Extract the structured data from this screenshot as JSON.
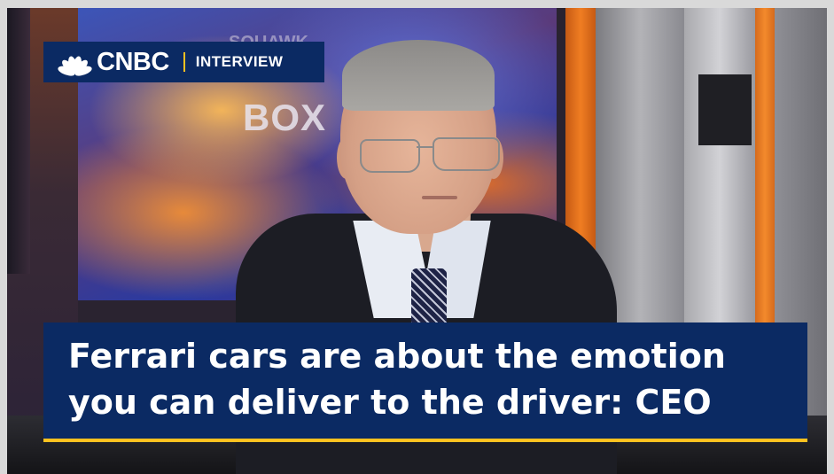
{
  "logo": {
    "brand": "CNBC",
    "icon": "peacock-icon",
    "segment": "INTERVIEW"
  },
  "background": {
    "wall_text": "BOX",
    "wall_text_top": "SQUAWK"
  },
  "headline": {
    "line1": "Ferrari cars are about the emotion",
    "line2": "you can deliver to the driver: CEO"
  },
  "colors": {
    "brand_navy": "#0b2a63",
    "accent_yellow": "#ffc220",
    "studio_orange": "#f07d22"
  }
}
